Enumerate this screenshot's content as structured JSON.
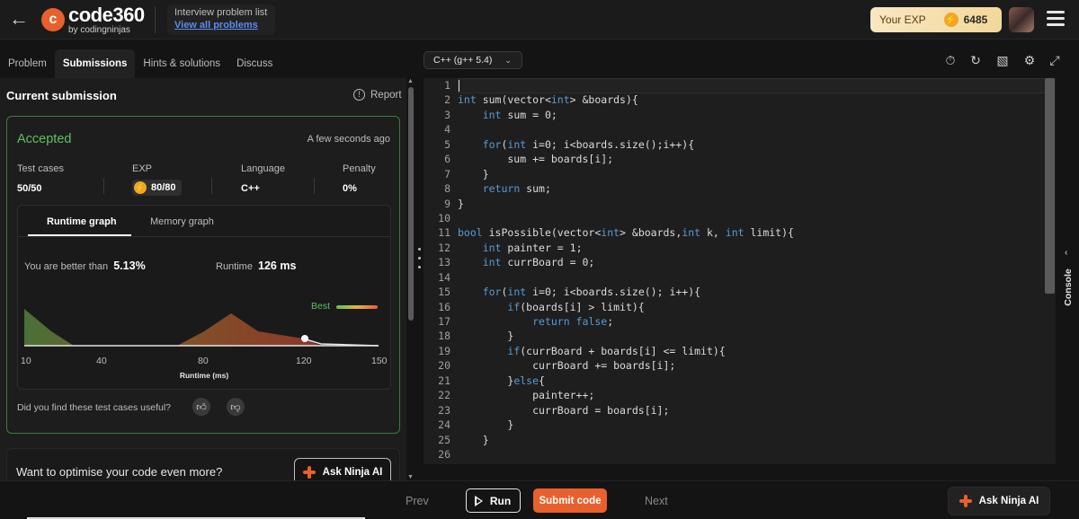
{
  "header": {
    "logo_main": "code360",
    "logo_sub": "by codingninjas",
    "problem_list_title": "Interview problem list",
    "problem_list_link": "View all problems",
    "exp_label": "Your EXP",
    "exp_value": "6485"
  },
  "tabs": [
    {
      "label": "Problem"
    },
    {
      "label": "Submissions",
      "active": true
    },
    {
      "label": "Hints & solutions"
    },
    {
      "label": "Discuss"
    }
  ],
  "submission": {
    "title": "Current submission",
    "report_label": "Report",
    "status": "Accepted",
    "time_ago": "A few seconds ago",
    "stats": {
      "test_cases_label": "Test cases",
      "test_cases_value": "50/50",
      "exp_label": "EXP",
      "exp_value": "80/80",
      "language_label": "Language",
      "language_value": "C++",
      "penalty_label": "Penalty",
      "penalty_value": "0%"
    },
    "graph": {
      "runtime_tab": "Runtime graph",
      "memory_tab": "Memory graph",
      "better_label": "You are better than",
      "better_value": "5.13%",
      "runtime_label": "Runtime",
      "runtime_value": "126 ms",
      "best_label": "Best",
      "x_ticks": [
        "10",
        "40",
        "80",
        "120",
        "150"
      ],
      "x_label": "Runtime (ms)"
    },
    "useful_question": "Did you find these test cases useful?"
  },
  "optimise": {
    "question": "Want to optimise your code even more?",
    "button": "Ask Ninja AI"
  },
  "editor": {
    "language": "C++ (g++ 5.4)",
    "line_numbers": [
      "1",
      "2",
      "3",
      "4",
      "5",
      "6",
      "7",
      "8",
      "9",
      "10",
      "11",
      "12",
      "13",
      "14",
      "15",
      "16",
      "17",
      "18",
      "19",
      "20",
      "21",
      "22",
      "23",
      "24",
      "25",
      "26"
    ],
    "lines": [
      "",
      "int sum(vector<int> &boards){",
      "    int sum = 0;",
      "",
      "    for(int i=0; i<boards.size();i++){",
      "        sum += boards[i];",
      "    }",
      "    return sum;",
      "}",
      "",
      "bool isPossible(vector<int> &boards,int k, int limit){",
      "    int painter = 1;",
      "    int currBoard = 0;",
      "",
      "    for(int i=0; i<boards.size(); i++){",
      "        if(boards[i] > limit){",
      "            return false;",
      "        }",
      "        if(currBoard + boards[i] <= limit){",
      "            currBoard += boards[i];",
      "        }else{",
      "            painter++;",
      "            currBoard = boards[i];",
      "        }",
      "    }",
      ""
    ],
    "console_label": "Console"
  },
  "footer": {
    "prev": "Prev",
    "run": "Run",
    "submit": "Submit code",
    "next": "Next",
    "ask_ninja": "Ask Ninja AI"
  },
  "colors": {
    "accent": "#e8602c",
    "accepted": "#5fbf5f",
    "keyword": "#569cd6",
    "link": "#5b8def"
  }
}
